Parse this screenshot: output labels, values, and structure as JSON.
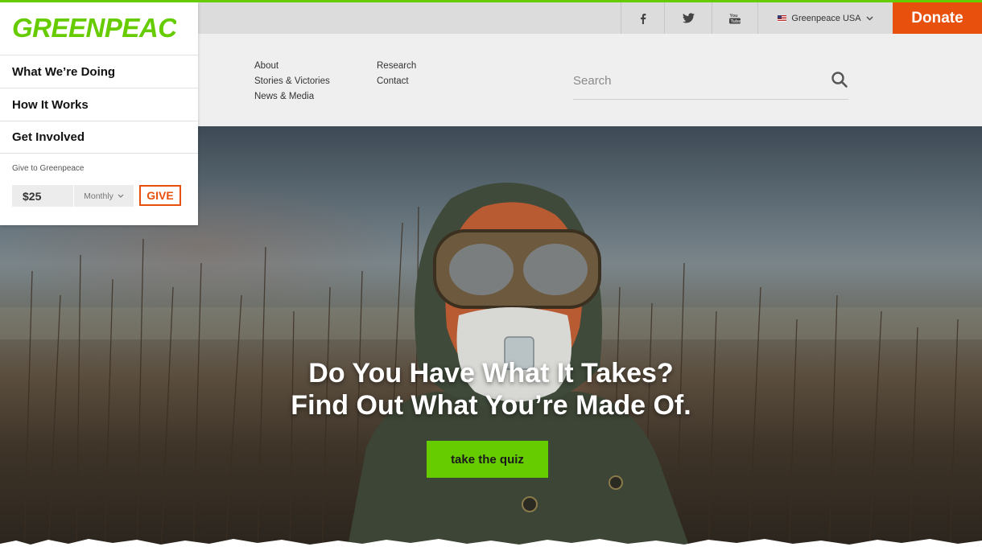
{
  "brand": {
    "logo_text": "GREENPEACE",
    "accent_color": "#66cc00",
    "donate_color": "#e8500e"
  },
  "utility_bar": {
    "social": [
      {
        "name": "facebook-icon"
      },
      {
        "name": "twitter-icon"
      },
      {
        "name": "youtube-icon"
      }
    ],
    "region_label": "Greenpeace USA",
    "donate_label": "Donate"
  },
  "sidebar": {
    "items": [
      {
        "label": "What We’re Doing"
      },
      {
        "label": "How It Works"
      },
      {
        "label": "Get Involved"
      }
    ],
    "give": {
      "label": "Give to Greenpeace",
      "amount": "$25",
      "frequency": "Monthly",
      "button_label": "GIVE"
    }
  },
  "subnav": {
    "col1": [
      "About",
      "Stories & Victories",
      "News & Media"
    ],
    "col2": [
      "Research",
      "Contact"
    ],
    "search_placeholder": "Search"
  },
  "hero": {
    "headline_1": "Do You Have What It Takes?",
    "headline_2": "Find Out What You’re Made Of.",
    "cta_label": "take the quiz"
  }
}
